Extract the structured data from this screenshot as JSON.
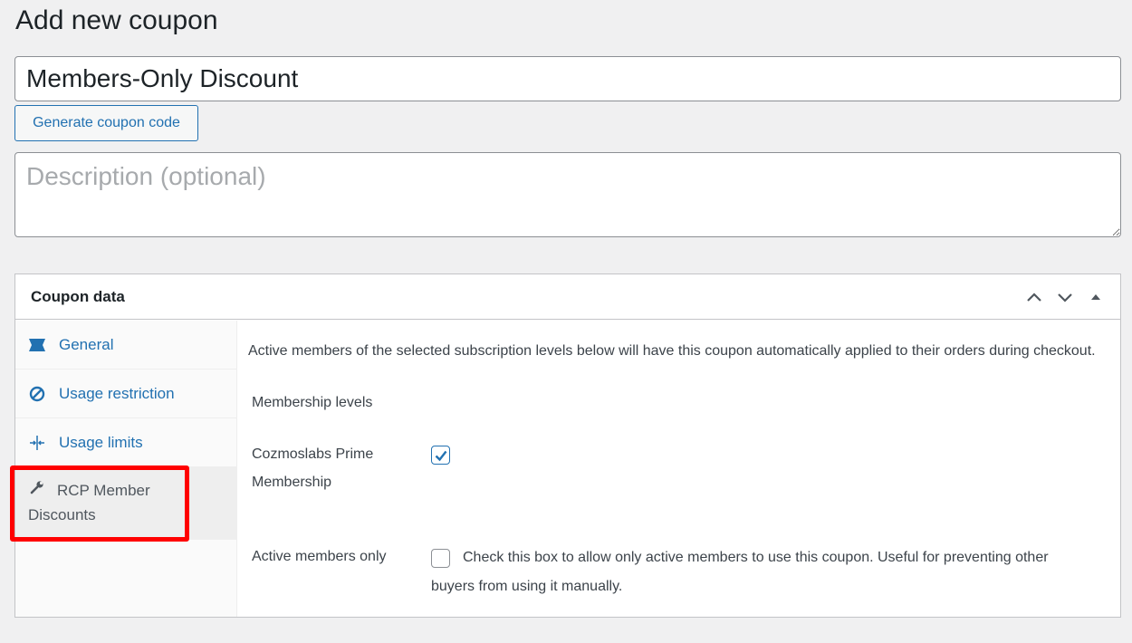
{
  "page": {
    "title": "Add new coupon"
  },
  "coupon_code": {
    "value": "Members-Only Discount"
  },
  "generate_button": {
    "label": "Generate coupon code"
  },
  "description": {
    "placeholder": "Description (optional)",
    "value": ""
  },
  "postbox": {
    "title": "Coupon data",
    "actions": [
      "chevron-up-icon",
      "chevron-down-icon",
      "triangle-up-icon"
    ]
  },
  "tabs": [
    {
      "label": "General",
      "icon": "ticket-icon",
      "active": false
    },
    {
      "label": "Usage restriction",
      "icon": "ban-icon",
      "active": false
    },
    {
      "label": "Usage limits",
      "icon": "arrows-in-icon",
      "active": false
    },
    {
      "label_line1": "RCP Member",
      "label_line2": "Discounts",
      "icon": "wrench-icon",
      "active": true
    }
  ],
  "panel": {
    "intro": "Active members of the selected subscription levels below will have this coupon automatically applied to their orders during checkout.",
    "membership_levels_label": "Membership levels",
    "level": {
      "label_line1": "Cozmoslabs Prime",
      "label_line2": "Membership",
      "checked": true
    },
    "active_only": {
      "label": "Active members only",
      "checked": false,
      "help_line1": "Check this box to allow only active members to use this coupon. Useful for preventing other",
      "help_line2": "buyers from using it manually."
    }
  },
  "colors": {
    "accent": "#2271b1",
    "highlight": "#ff0000",
    "background": "#f0f0f1"
  }
}
